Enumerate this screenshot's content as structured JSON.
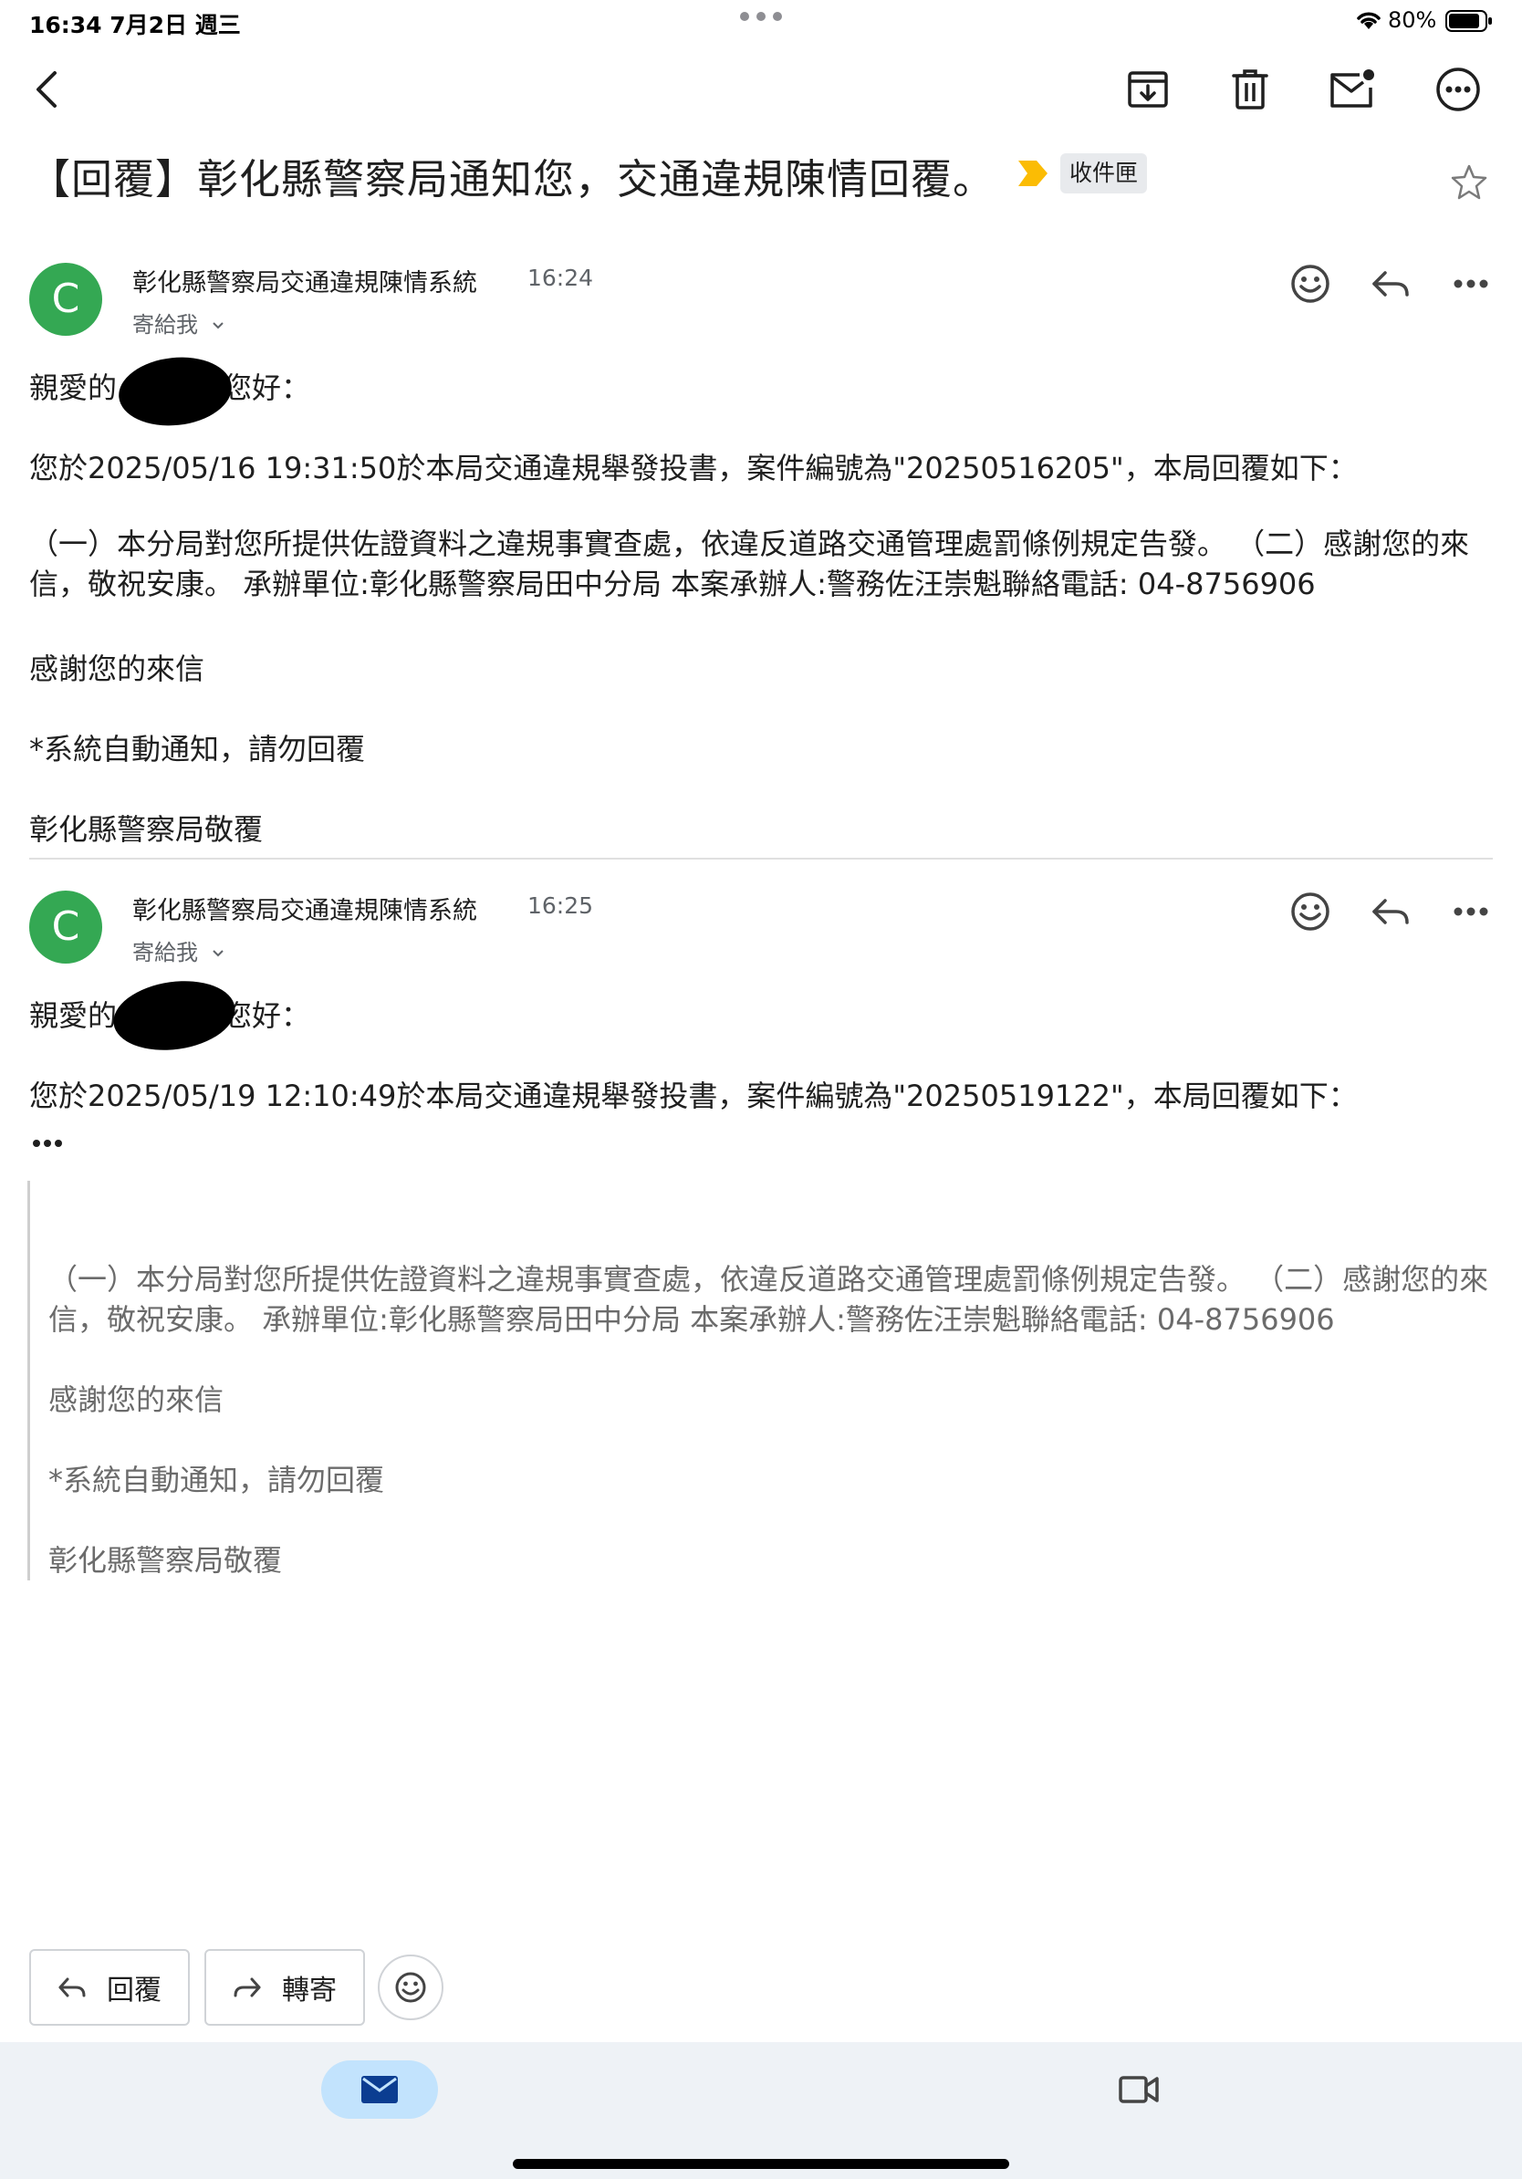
{
  "status_bar": {
    "time_date": "16:34  7月2日 週三",
    "battery": "80%"
  },
  "toolbar": {
    "icons": [
      "back-arrow-icon",
      "archive-icon",
      "trash-icon",
      "mark-unread-icon",
      "more-circle-icon"
    ]
  },
  "thread": {
    "subject": "【回覆】彰化縣警察局通知您，交通違規陳情回覆。",
    "label": "收件匣",
    "label_color": "#fbbc04"
  },
  "messages": [
    {
      "avatar_letter": "C",
      "avatar_color": "#34a853",
      "sender": "彰化縣警察局交通違規陳情系統",
      "time": "16:24",
      "recipient": "寄給我",
      "greeting_prefix": "親愛的",
      "greeting_suffix": "您好：",
      "line1": "您於2025/05/16 19:31:50於本局交通違規舉發投書，案件編號為\"20250516205\"，本局回覆如下：",
      "line2": "（一）本分局對您所提供佐證資料之違規事實查處，依違反道路交通管理處罰條例規定告發。 （二）感謝您的來信，敬祝安康。 承辦單位:彰化縣警察局田中分局 本案承辦人:警務佐汪崇魁聯絡電話: 04-8756906",
      "line3": "感謝您的來信",
      "line4": "*系統自動通知，請勿回覆",
      "line5": "彰化縣警察局敬覆"
    },
    {
      "avatar_letter": "C",
      "avatar_color": "#34a853",
      "sender": "彰化縣警察局交通違規陳情系統",
      "time": "16:25",
      "recipient": "寄給我",
      "greeting_prefix": "親愛的",
      "greeting_suffix": "您好：",
      "line1": "您於2025/05/19 12:10:49於本局交通違規舉發投書，案件編號為\"20250519122\"，本局回覆如下：",
      "quoted": {
        "line2": "（一）本分局對您所提供佐證資料之違規事實查處，依違反道路交通管理處罰條例規定告發。 （二）感謝您的來信，敬祝安康。 承辦單位:彰化縣警察局田中分局 本案承辦人:警務佐汪崇魁聯絡電話: 04-8756906",
        "line3": "感謝您的來信",
        "line4": "*系統自動通知，請勿回覆",
        "line5": "彰化縣警察局敬覆"
      }
    }
  ],
  "actions": {
    "reply": "回覆",
    "forward": "轉寄"
  },
  "bottom_nav": {
    "active_color": "#c2e3fd",
    "items": [
      "mail-icon",
      "video-icon"
    ]
  }
}
